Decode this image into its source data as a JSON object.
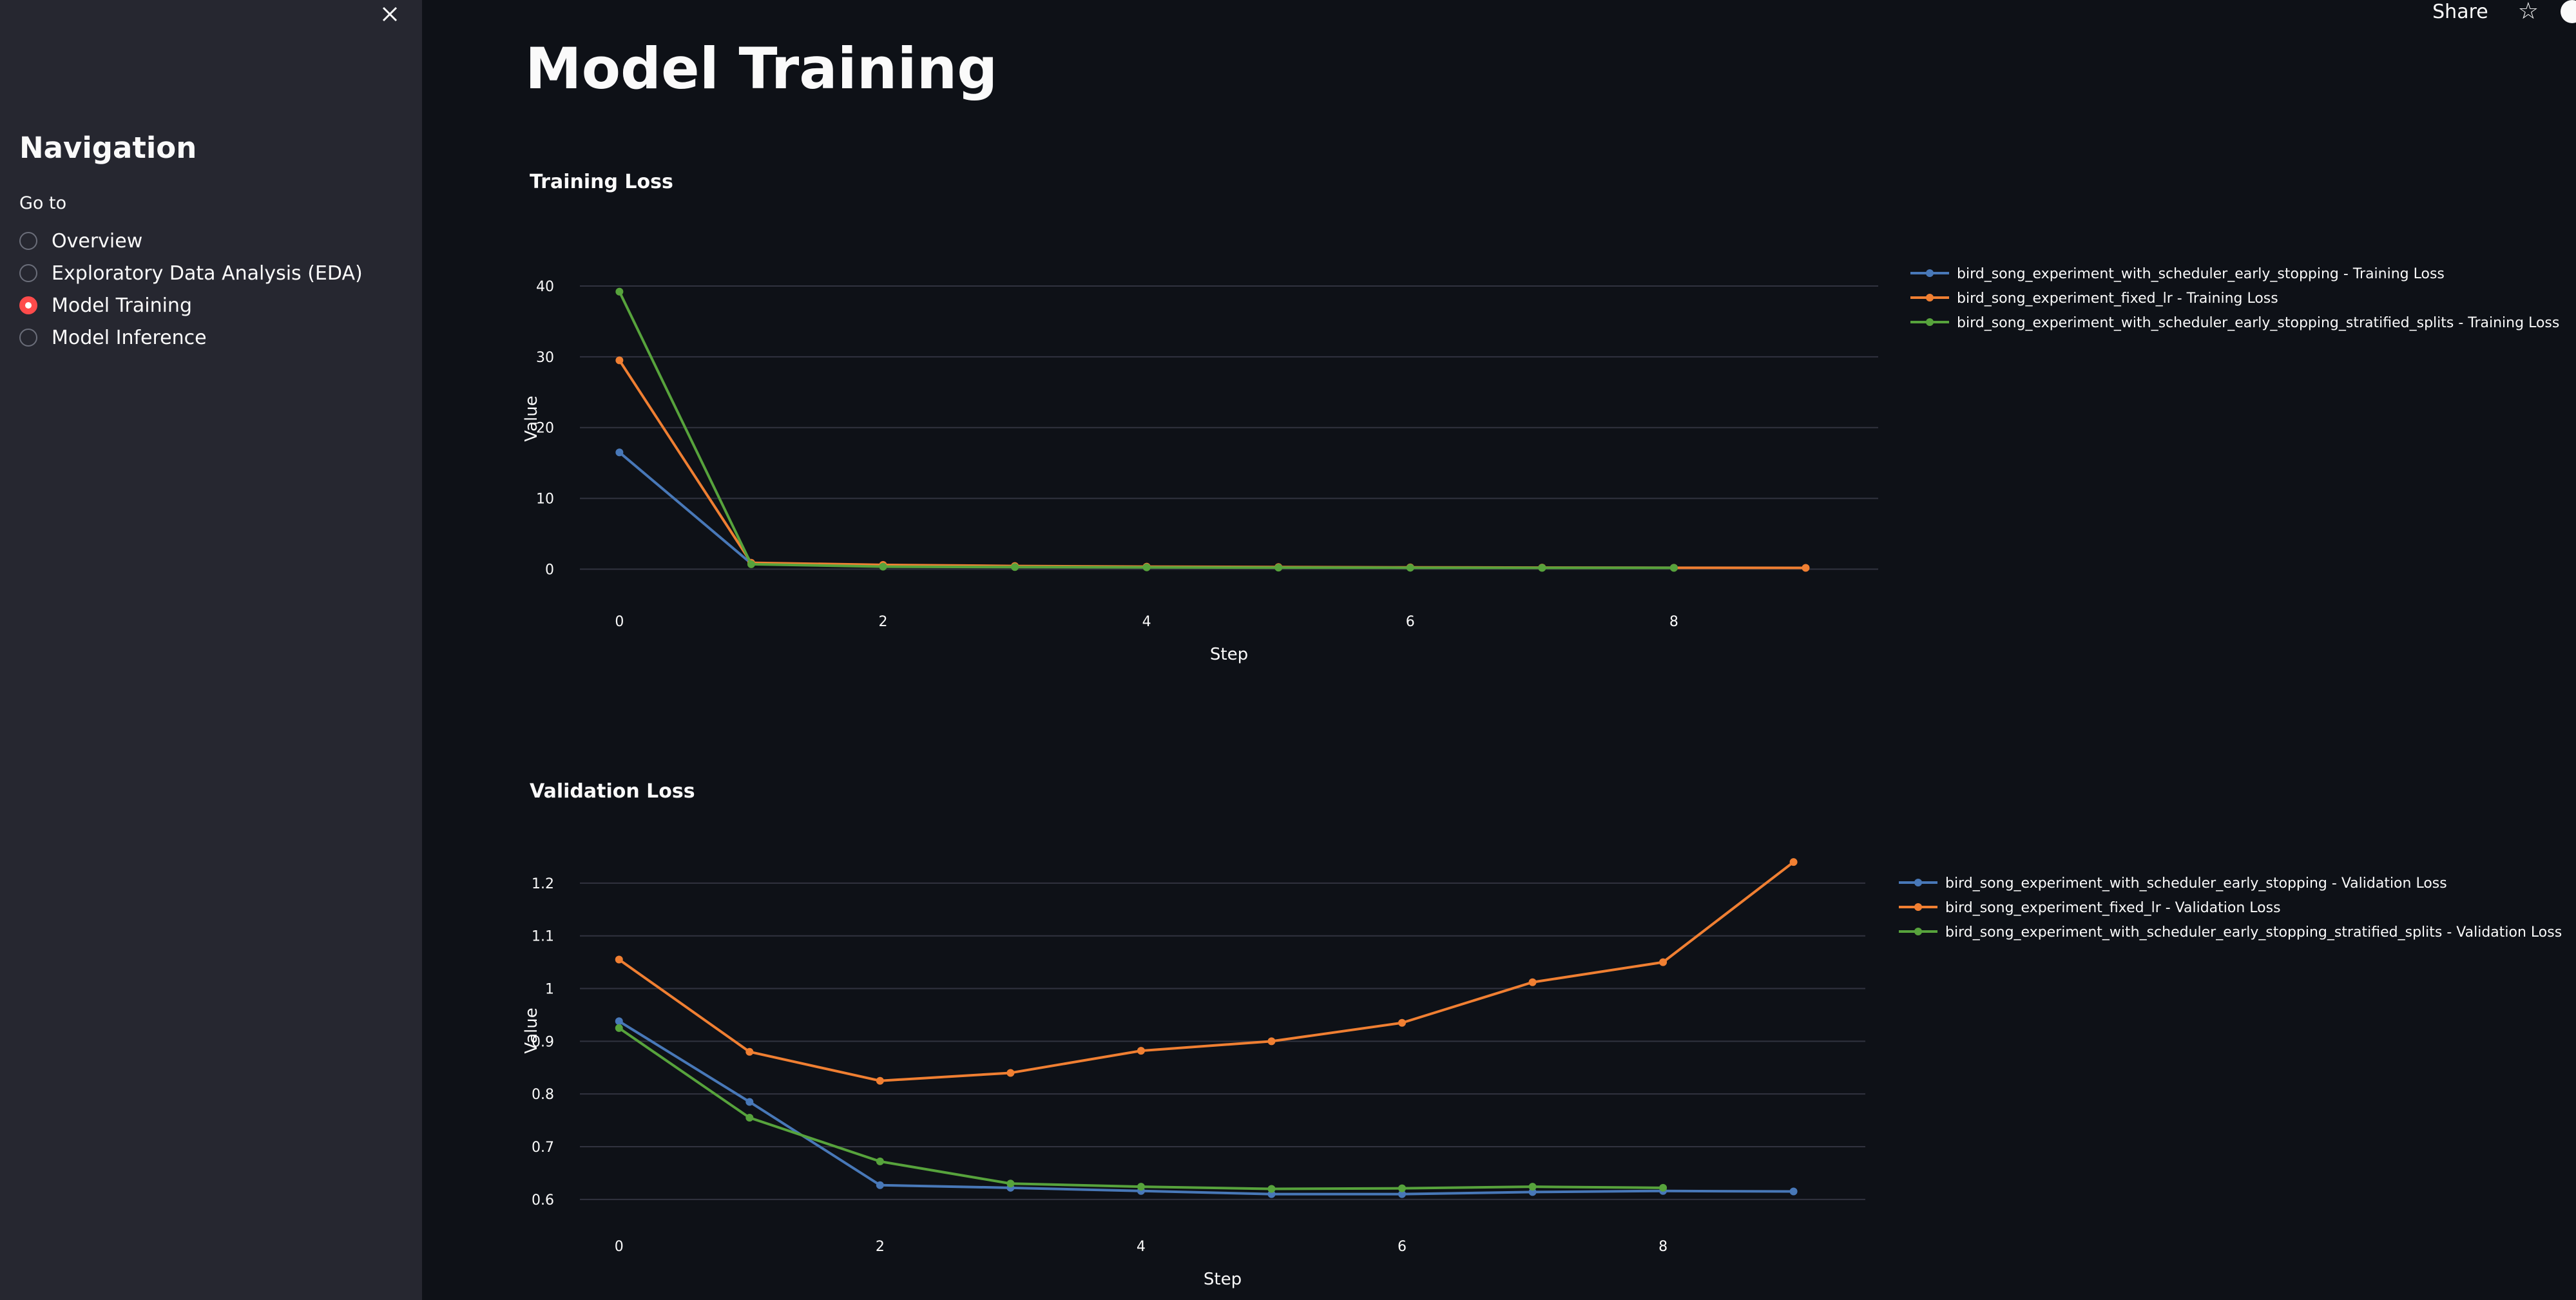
{
  "sidebar": {
    "title": "Navigation",
    "radio_label": "Go to",
    "options": [
      {
        "label": "Overview",
        "selected": false
      },
      {
        "label": "Exploratory Data Analysis (EDA)",
        "selected": false
      },
      {
        "label": "Model Training",
        "selected": true
      },
      {
        "label": "Model Inference",
        "selected": false
      }
    ],
    "close_icon": "close-icon"
  },
  "header": {
    "share_label": "Share",
    "star_icon": "star-icon",
    "github_icon": "github-icon"
  },
  "main": {
    "title": "Model Training"
  },
  "colors": {
    "blue": "#4878b8",
    "orange": "#f07f32",
    "green": "#57a33c",
    "accent": "#ff4b4b",
    "background": "#0e1117",
    "sidebar": "#262730"
  },
  "chart_data": [
    {
      "type": "line",
      "title": "Training Loss",
      "xlabel": "Step",
      "ylabel": "Value",
      "xlim": [
        -0.3,
        9.55
      ],
      "ylim": [
        -1.5,
        44
      ],
      "xticks": [
        0,
        2,
        4,
        6,
        8
      ],
      "yticks": [
        0,
        10,
        20,
        30,
        40
      ],
      "grid": true,
      "legend_position": "right",
      "series": [
        {
          "name": "bird_song_experiment_with_scheduler_early_stopping - Training Loss",
          "color": "#4878b8",
          "x": [
            0,
            1,
            2,
            3,
            4,
            5,
            6,
            7,
            8
          ],
          "y": [
            16.5,
            0.8,
            0.5,
            0.35,
            0.3,
            0.25,
            0.22,
            0.2,
            0.2
          ]
        },
        {
          "name": "bird_song_experiment_fixed_lr - Training Loss",
          "color": "#f07f32",
          "x": [
            0,
            1,
            2,
            3,
            4,
            5,
            6,
            7,
            8,
            9
          ],
          "y": [
            29.5,
            0.9,
            0.6,
            0.45,
            0.35,
            0.3,
            0.25,
            0.22,
            0.2,
            0.18
          ]
        },
        {
          "name": "bird_song_experiment_with_scheduler_early_stopping_stratified_splits - Training Loss",
          "color": "#57a33c",
          "x": [
            0,
            1,
            2,
            3,
            4,
            5,
            6,
            7,
            8
          ],
          "y": [
            39.2,
            0.7,
            0.35,
            0.3,
            0.25,
            0.22,
            0.2,
            0.18,
            0.18
          ]
        }
      ]
    },
    {
      "type": "line",
      "title": "Validation Loss",
      "xlabel": "Step",
      "ylabel": "Value",
      "xlim": [
        -0.3,
        9.55
      ],
      "ylim": [
        0.59,
        1.25
      ],
      "xticks": [
        0,
        2,
        4,
        6,
        8
      ],
      "yticks": [
        0.6,
        0.7,
        0.8,
        0.9,
        1,
        1.1,
        1.2
      ],
      "ytick_labels": [
        "0.6",
        "0.7",
        "0.8",
        "0.9",
        "1",
        "1.1",
        "1.2"
      ],
      "grid": true,
      "legend_position": "right",
      "series": [
        {
          "name": "bird_song_experiment_with_scheduler_early_stopping - Validation Loss",
          "color": "#4878b8",
          "x": [
            0,
            1,
            2,
            3,
            4,
            5,
            6,
            7,
            8,
            9
          ],
          "y": [
            0.938,
            0.785,
            0.627,
            0.622,
            0.616,
            0.61,
            0.61,
            0.614,
            0.616,
            0.615
          ]
        },
        {
          "name": "bird_song_experiment_fixed_lr - Validation Loss",
          "color": "#f07f32",
          "x": [
            0,
            1,
            2,
            3,
            4,
            5,
            6,
            7,
            8,
            9
          ],
          "y": [
            1.055,
            0.88,
            0.825,
            0.84,
            0.882,
            0.9,
            0.935,
            1.012,
            1.05,
            1.24
          ]
        },
        {
          "name": "bird_song_experiment_with_scheduler_early_stopping_stratified_splits - Validation Loss",
          "color": "#57a33c",
          "x": [
            0,
            1,
            2,
            3,
            4,
            5,
            6,
            7,
            8
          ],
          "y": [
            0.925,
            0.755,
            0.672,
            0.63,
            0.624,
            0.62,
            0.621,
            0.624,
            0.622
          ]
        }
      ]
    }
  ]
}
